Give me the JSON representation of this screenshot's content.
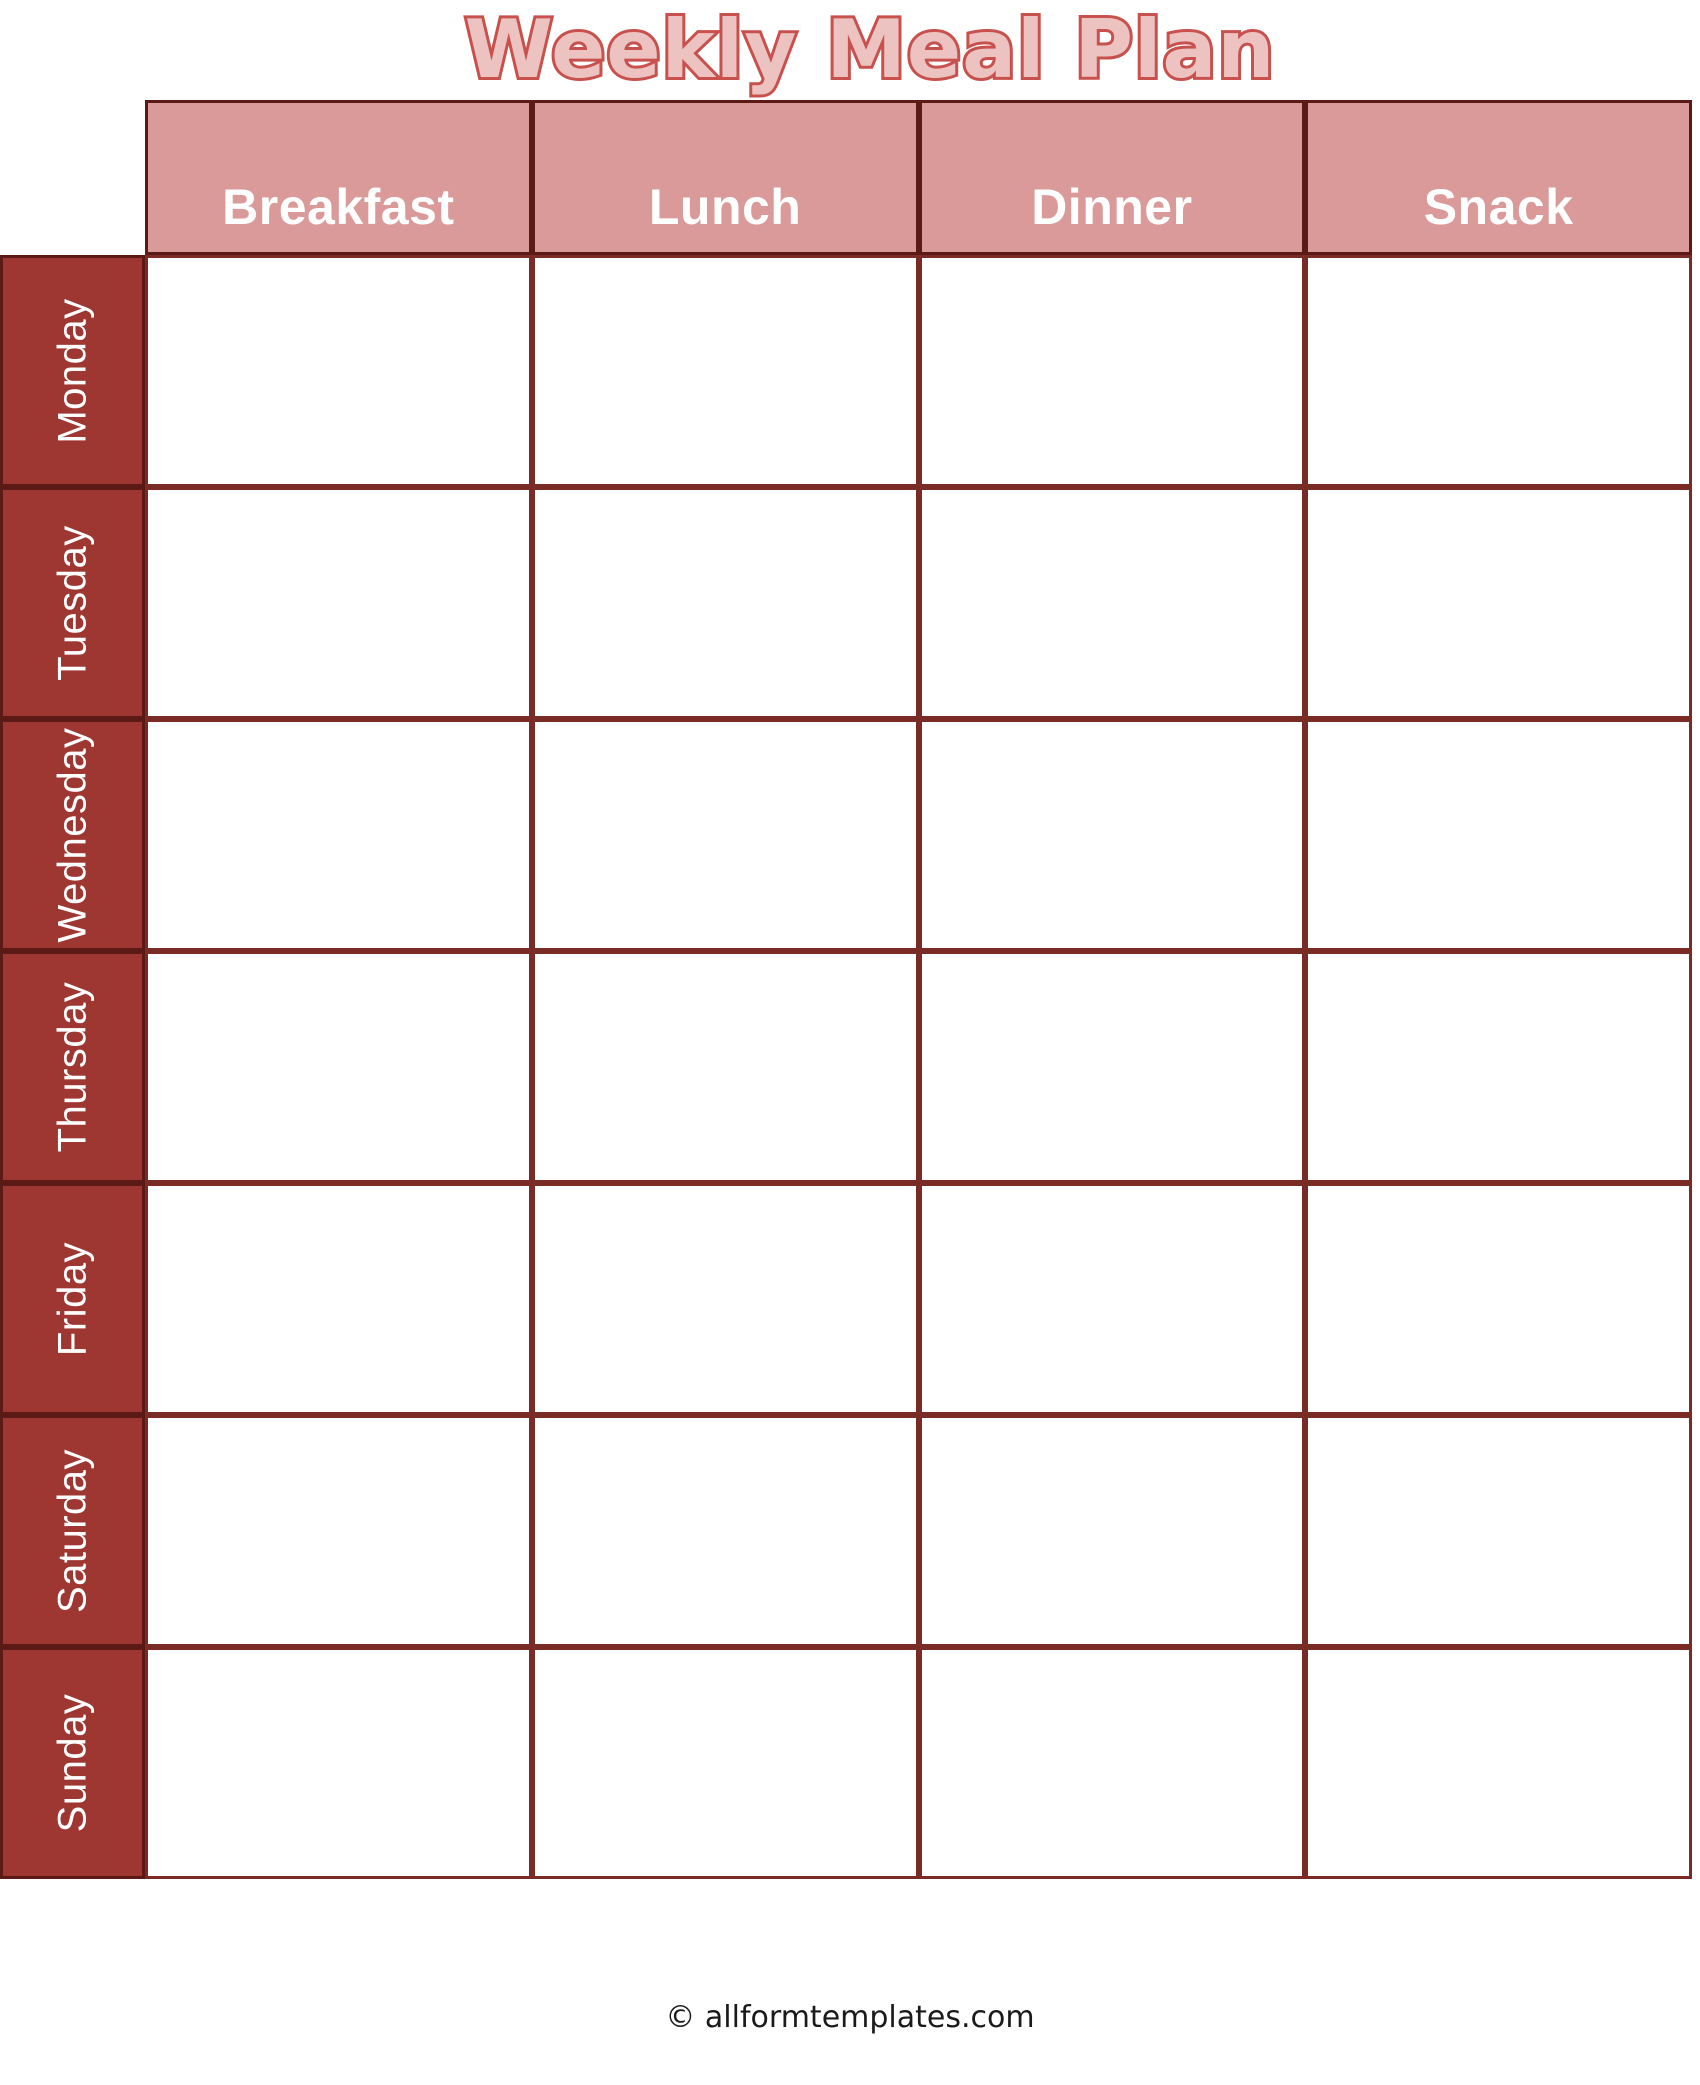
{
  "page": {
    "title": "Weekly Meal Plan",
    "background_color": "#FFFFFF"
  },
  "colors": {
    "title_fill": "#EDC3C1",
    "title_outline": "#C8514E",
    "column_header_bg": "#DA9A99",
    "column_header_text": "#FFFFFF",
    "day_label_bg": "#9E3632",
    "day_label_text": "#FFFFFF",
    "grid_border": "#7B2B26",
    "header_border": "#5C1A17",
    "cell_bg": "#FFFFFF"
  },
  "table": {
    "corner_label": "",
    "columns": [
      {
        "label": "Breakfast"
      },
      {
        "label": "Lunch"
      },
      {
        "label": "Dinner"
      },
      {
        "label": "Snack"
      }
    ],
    "rows": [
      {
        "day": "Monday",
        "cells": [
          "",
          "",
          "",
          ""
        ]
      },
      {
        "day": "Tuesday",
        "cells": [
          "",
          "",
          "",
          ""
        ]
      },
      {
        "day": "Wednesday",
        "cells": [
          "",
          "",
          "",
          ""
        ]
      },
      {
        "day": "Thursday",
        "cells": [
          "",
          "",
          "",
          ""
        ]
      },
      {
        "day": "Friday",
        "cells": [
          "",
          "",
          "",
          ""
        ]
      },
      {
        "day": "Saturday",
        "cells": [
          "",
          "",
          "",
          ""
        ]
      },
      {
        "day": "Sunday",
        "cells": [
          "",
          "",
          "",
          ""
        ]
      }
    ]
  },
  "footer": {
    "credit": "© allformtemplates.com"
  }
}
